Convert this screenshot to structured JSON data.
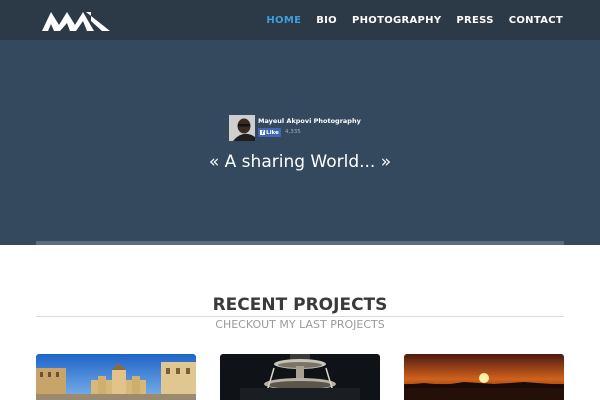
{
  "nav": {
    "logo": "MA",
    "items": [
      {
        "label": "HOME",
        "active": true
      },
      {
        "label": "BIO",
        "active": false
      },
      {
        "label": "PHOTOGRAPHY",
        "active": false
      },
      {
        "label": "PRESS",
        "active": false
      },
      {
        "label": "CONTACT",
        "active": false
      }
    ]
  },
  "hero": {
    "fb_widget": {
      "page_name": "Mayeul Akpovi Photography",
      "like_label": "Like",
      "like_count": "4,335"
    },
    "tagline": "« A sharing World... »"
  },
  "projects": {
    "title": "RECENT PROJECTS",
    "subtitle": "CHECKOUT MY LAST PROJECTS",
    "thumbnails": [
      "city-square-photo",
      "fountain-night-photo",
      "sunset-photo"
    ]
  },
  "colors": {
    "navbar_bg": "#2c3a48",
    "hero_bg": "#34495e",
    "active_link": "#3aa0dc"
  }
}
